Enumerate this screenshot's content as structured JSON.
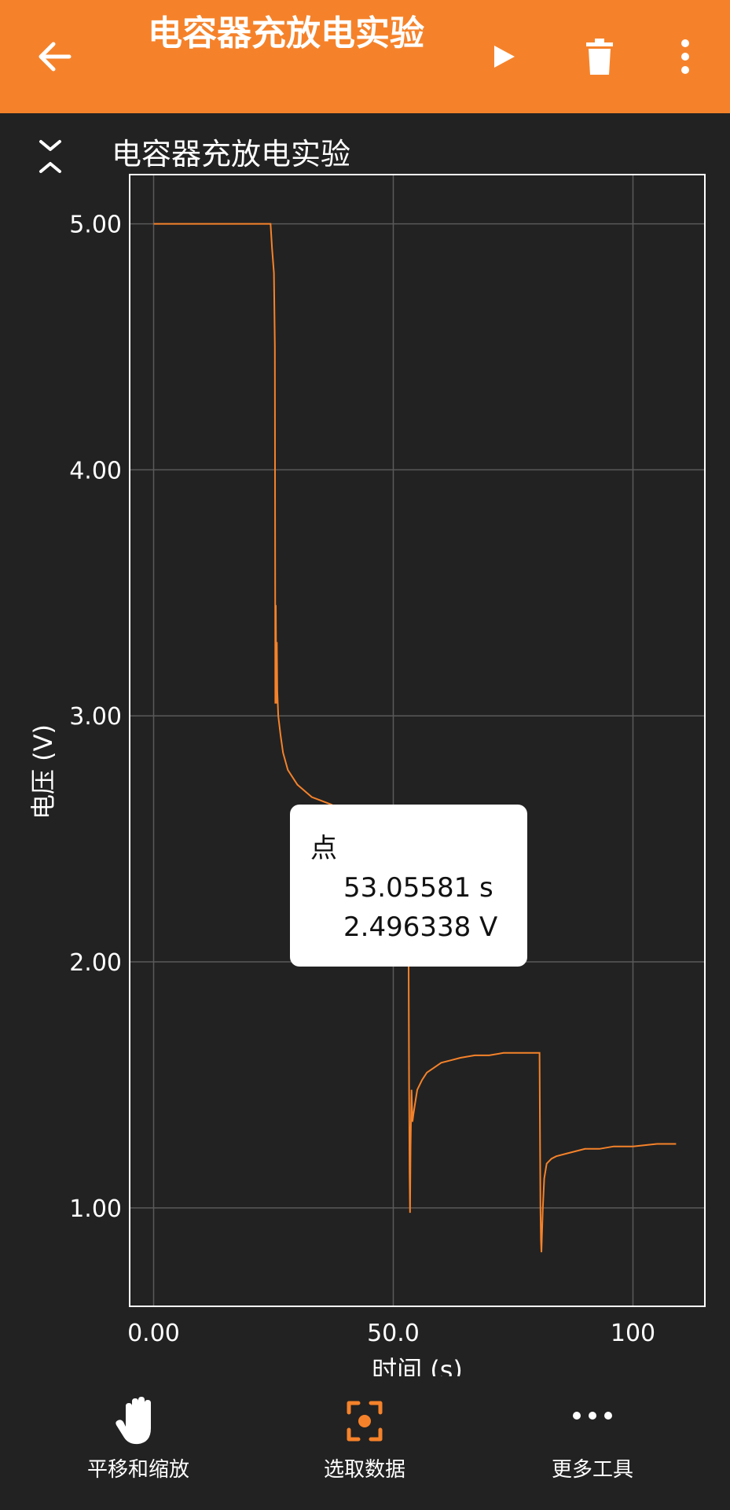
{
  "appbar": {
    "title": "电容器充放电实验",
    "back_icon": "arrow-left-icon",
    "play_icon": "play-icon",
    "delete_icon": "trash-icon",
    "menu_icon": "more-vertical-icon",
    "background": "#f5822a"
  },
  "chart_header": {
    "title": "电容器充放电实验",
    "collapse_icon": "collapse-icon"
  },
  "chart_data": {
    "type": "line",
    "title": "",
    "xlabel": "时间 (s)",
    "ylabel": "电压 (V)",
    "xlim": [
      -5,
      115
    ],
    "ylim": [
      0.6,
      5.2
    ],
    "x_ticks": [
      0,
      50,
      100
    ],
    "x_tick_labels": [
      "0.00",
      "50.0",
      "100"
    ],
    "y_ticks": [
      1,
      2,
      3,
      4,
      5
    ],
    "y_tick_labels": [
      "1.00",
      "2.00",
      "3.00",
      "4.00",
      "5.00"
    ],
    "grid": true,
    "line_color": "#f5822a",
    "series": [
      {
        "x": [
          0,
          24.4,
          24.7,
          25.1,
          25.3,
          25.4,
          25.5,
          25.6,
          25.7,
          25.8,
          26.0,
          26.5,
          27.0,
          28.0,
          30.0,
          33.0,
          37.0,
          41.0,
          45.0,
          48.0,
          50.0,
          51.0,
          52.0,
          52.6,
          52.9,
          53.0,
          53.06,
          53.1,
          53.2,
          53.3,
          53.4,
          53.5,
          53.6,
          53.8,
          54.0,
          54.2,
          54.5,
          55.0,
          56.0,
          57.0,
          58.5,
          60.0,
          62.0,
          64.0,
          67.0,
          70.0,
          73.0,
          76.0,
          80.5,
          80.6,
          80.7,
          80.8,
          80.9,
          81.0,
          81.2,
          81.5,
          82.0,
          83.0,
          84.0,
          86.0,
          88.0,
          90.0,
          93.0,
          96.0,
          100.0,
          105.0,
          109.0
        ],
        "y": [
          5.0,
          5.0,
          4.9,
          4.8,
          4.5,
          3.05,
          3.45,
          3.05,
          3.3,
          3.1,
          3.0,
          2.92,
          2.85,
          2.78,
          2.72,
          2.67,
          2.64,
          2.6,
          2.56,
          2.53,
          2.52,
          2.5,
          2.49,
          2.47,
          2.48,
          2.5,
          2.496,
          2.45,
          2.0,
          1.5,
          1.15,
          0.98,
          1.25,
          1.48,
          1.35,
          1.38,
          1.42,
          1.48,
          1.52,
          1.55,
          1.57,
          1.59,
          1.6,
          1.61,
          1.62,
          1.62,
          1.63,
          1.63,
          1.63,
          1.3,
          1.0,
          0.87,
          0.82,
          0.88,
          1.0,
          1.12,
          1.18,
          1.2,
          1.21,
          1.22,
          1.23,
          1.24,
          1.24,
          1.25,
          1.25,
          1.26,
          1.26
        ]
      }
    ],
    "marker": {
      "x": 53.05581,
      "y": 2.496338
    }
  },
  "tooltip": {
    "title": "点",
    "x_text": "53.05581 s",
    "y_text": "2.496338 V"
  },
  "toolbar": {
    "items": [
      {
        "label": "平移和缩放",
        "icon": "hand-icon"
      },
      {
        "label": "选取数据",
        "icon": "select-data-icon"
      },
      {
        "label": "更多工具",
        "icon": "more-horizontal-icon"
      }
    ]
  }
}
